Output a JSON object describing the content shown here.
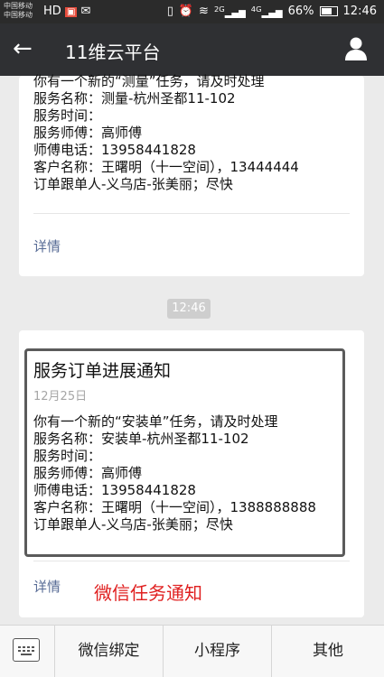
{
  "status_bar": {
    "carrier1": "中国移动",
    "carrier2": "中国移动",
    "network1": "2G",
    "network2": "4G",
    "battery": "66%",
    "time": "12:46"
  },
  "app_bar": {
    "title": "11维云平台"
  },
  "message_top": {
    "lines": [
      "你有一个新的“测量”任务，请及时处理",
      "服务名称：测量-杭州圣都11-102",
      "服务时间：",
      "服务师傅：高师傅",
      "师傅电话：13958441828",
      "客户名称：王曙明（十一空间），13444444",
      "订单跟单人-义乌店-张美丽；尽快"
    ],
    "detail_label": "详情"
  },
  "timestamp": "12:46",
  "message_bottom": {
    "title": "服务订单进展通知",
    "date": "12月25日",
    "lines": [
      "你有一个新的“安装单”任务，请及时处理",
      "服务名称：安装单-杭州圣都11-102",
      "服务时间：",
      "服务师傅：高师傅",
      "师傅电话：13958441828",
      "客户名称：王曙明（十一空间），1388888888",
      "订单跟单人-义乌店-张美丽；尽快"
    ],
    "detail_label": "详情",
    "annotation": "微信任务通知"
  },
  "bottom_menu": {
    "items": [
      "微信绑定",
      "小程序",
      "其他"
    ]
  }
}
